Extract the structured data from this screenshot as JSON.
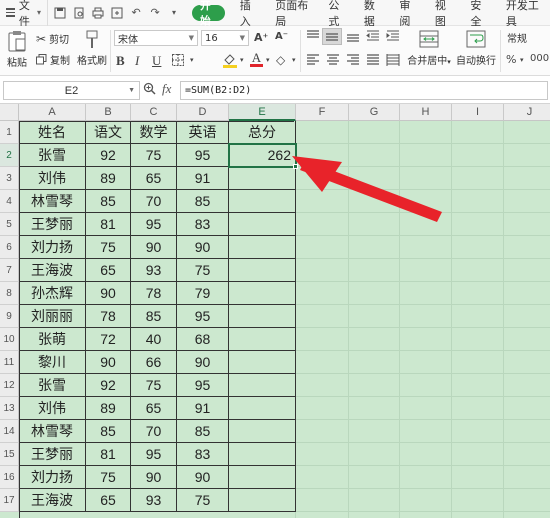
{
  "menubar": {
    "file_label": "文件",
    "tabs": [
      "开始",
      "插入",
      "页面布局",
      "公式",
      "数据",
      "审阅",
      "视图",
      "安全",
      "开发工具"
    ],
    "active_tab": "开始"
  },
  "ribbon": {
    "paste_label": "粘贴",
    "cut_label": "剪切",
    "copy_label": "复制",
    "format_painter_label": "格式刷",
    "font_name": "宋体",
    "font_size": "16",
    "merge_center_label": "合并居中",
    "wrap_text_label": "自动换行",
    "number_format": "常规",
    "accent_color": "#2d9e4b"
  },
  "formula_bar": {
    "name_box": "E2",
    "fx_label": "fx",
    "formula": "=SUM(B2:D2)"
  },
  "grid": {
    "columns": [
      "A",
      "B",
      "C",
      "D",
      "E",
      "F",
      "G",
      "H",
      "I",
      "J"
    ],
    "rows": [
      "1",
      "2",
      "3",
      "4",
      "5",
      "6",
      "7",
      "8",
      "9",
      "10",
      "11",
      "12",
      "13",
      "14",
      "15",
      "16",
      "17"
    ],
    "selected_cell": "E2",
    "headers": [
      "姓名",
      "语文",
      "数学",
      "英语",
      "总分"
    ],
    "data": [
      [
        "张雪",
        "92",
        "75",
        "95",
        "262"
      ],
      [
        "刘伟",
        "89",
        "65",
        "91",
        ""
      ],
      [
        "林雪琴",
        "85",
        "70",
        "85",
        ""
      ],
      [
        "王梦丽",
        "81",
        "95",
        "83",
        ""
      ],
      [
        "刘力扬",
        "75",
        "90",
        "90",
        ""
      ],
      [
        "王海波",
        "65",
        "93",
        "75",
        ""
      ],
      [
        "孙杰辉",
        "90",
        "78",
        "79",
        ""
      ],
      [
        "刘丽丽",
        "78",
        "85",
        "95",
        ""
      ],
      [
        "张萌",
        "72",
        "40",
        "68",
        ""
      ],
      [
        "黎川",
        "90",
        "66",
        "90",
        ""
      ],
      [
        "张雪",
        "92",
        "75",
        "95",
        ""
      ],
      [
        "刘伟",
        "89",
        "65",
        "91",
        ""
      ],
      [
        "林雪琴",
        "85",
        "70",
        "85",
        ""
      ],
      [
        "王梦丽",
        "81",
        "95",
        "83",
        ""
      ],
      [
        "刘力扬",
        "75",
        "90",
        "90",
        ""
      ],
      [
        "王海波",
        "65",
        "93",
        "75",
        ""
      ]
    ],
    "sheet_color": "#cce8cf",
    "arrow_color": "#e8232a"
  }
}
